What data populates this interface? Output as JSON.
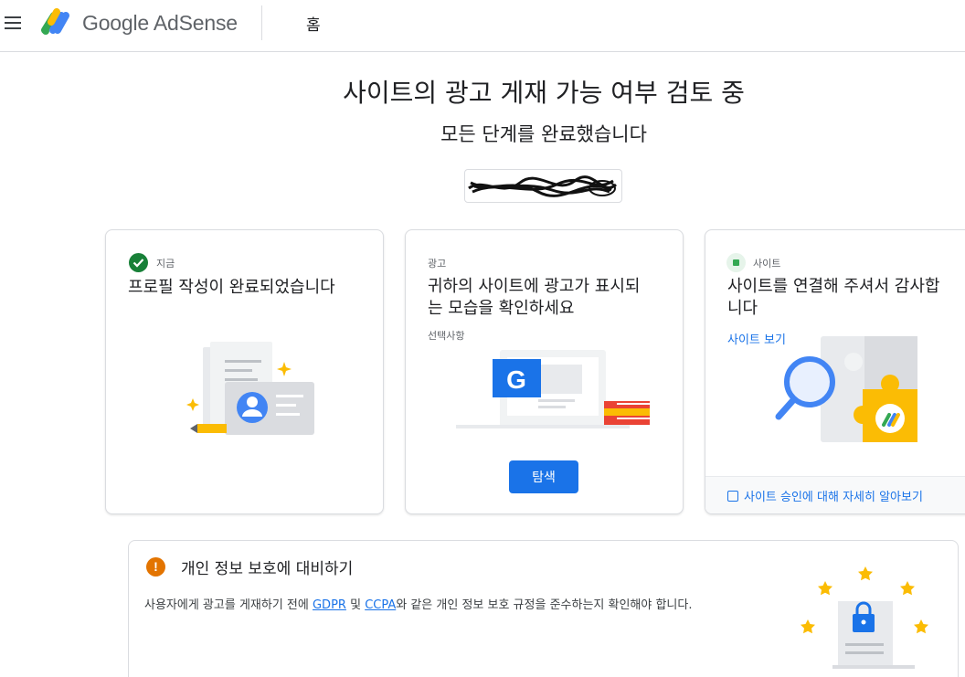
{
  "header": {
    "brand": "Google AdSense",
    "breadcrumb": "홈"
  },
  "main": {
    "title": "사이트의 광고 게재 가능 여부 검토 중",
    "subtitle": "모든 단계를 완료했습니다"
  },
  "cards": {
    "profile": {
      "label": "지금",
      "title": "프로필 작성이 완료되었습니다"
    },
    "ads": {
      "label": "광고",
      "title_line1": "귀하의 사이트에 광고가 표시되",
      "title_line2": "는 모습을 확인하세요",
      "optional": "선택사항",
      "button": "탐색"
    },
    "site": {
      "label": "사이트",
      "title_line1": "사이트를 연결해 주셔서 감사합",
      "title_line2": "니다",
      "link": "사이트 보기",
      "footer_link": "사이트 승인에 대해 자세히 알아보기"
    }
  },
  "privacy": {
    "title": "개인 정보 보호에 대비하기",
    "text_before": "사용자에게 광고를 게재하기 전에 ",
    "gdpr": "GDPR",
    "text_and": " 및 ",
    "ccpa": "CCPA",
    "text_after": "와 같은 개인 정보 보호 규정을 준수하는지 확인해야 합니다."
  },
  "colors": {
    "primary": "#1a73e8",
    "success": "#188038",
    "warning": "#e37400",
    "star": "#fbbc04"
  }
}
